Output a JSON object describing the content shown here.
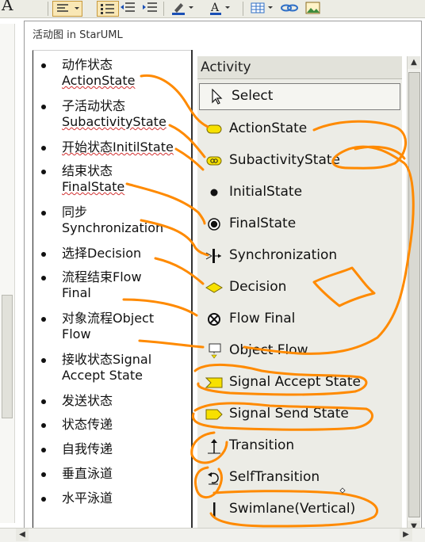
{
  "toolbar": {
    "font_letter": "A",
    "icons": [
      "align-left-icon",
      "bullet-list-icon",
      "decrease-indent-icon",
      "increase-indent-icon",
      "highlight-pen-icon",
      "font-color-icon",
      "table-icon",
      "link-icon",
      "image-icon"
    ]
  },
  "window": {
    "title": "活动图 in StarUML"
  },
  "notes": {
    "items": [
      {
        "line1": "动作状态",
        "line2": "ActionState"
      },
      {
        "line1": "子活动状态",
        "line2": "SubactivityState"
      },
      {
        "line1": "开始状态InitilState",
        "line2": ""
      },
      {
        "line1": "结束状态",
        "line2": "FinalState"
      },
      {
        "line1": "同步",
        "line2": "Synchronization"
      },
      {
        "line1": "选择Decision",
        "line2": ""
      },
      {
        "line1": "流程结束Flow",
        "line2": "Final"
      },
      {
        "line1": "对象流程Object",
        "line2": "Flow"
      },
      {
        "line1": "接收状态Signal",
        "line2": "Accept State"
      },
      {
        "line1": "发送状态",
        "line2": ""
      },
      {
        "line1": "状态传递",
        "line2": ""
      },
      {
        "line1": "自我传递",
        "line2": ""
      },
      {
        "line1": "垂直泳道",
        "line2": ""
      },
      {
        "line1": "水平泳道",
        "line2": ""
      }
    ]
  },
  "palette": {
    "header": "Activity",
    "items": [
      {
        "label": "Select",
        "icon": "cursor-arrow-icon",
        "selected": true
      },
      {
        "label": "ActionState",
        "icon": "action-state-icon"
      },
      {
        "label": "SubactivityState",
        "icon": "subactivity-state-icon"
      },
      {
        "label": "InitialState",
        "icon": "initial-state-icon"
      },
      {
        "label": "FinalState",
        "icon": "final-state-icon"
      },
      {
        "label": "Synchronization",
        "icon": "synchronization-icon"
      },
      {
        "label": "Decision",
        "icon": "decision-icon"
      },
      {
        "label": "Flow Final",
        "icon": "flow-final-icon"
      },
      {
        "label": "Object Flow",
        "icon": "object-flow-icon"
      },
      {
        "label": "Signal Accept State",
        "icon": "signal-accept-icon"
      },
      {
        "label": "Signal Send State",
        "icon": "signal-send-icon"
      },
      {
        "label": "Transition",
        "icon": "transition-icon"
      },
      {
        "label": "SelfTransition",
        "icon": "self-transition-icon"
      },
      {
        "label": "Swimlane(Vertical)",
        "icon": "swimlane-vertical-icon"
      }
    ]
  },
  "colors": {
    "annotation": "#ff8a00",
    "state_fill": "#f7e100",
    "spellcheck": "#d23030"
  }
}
